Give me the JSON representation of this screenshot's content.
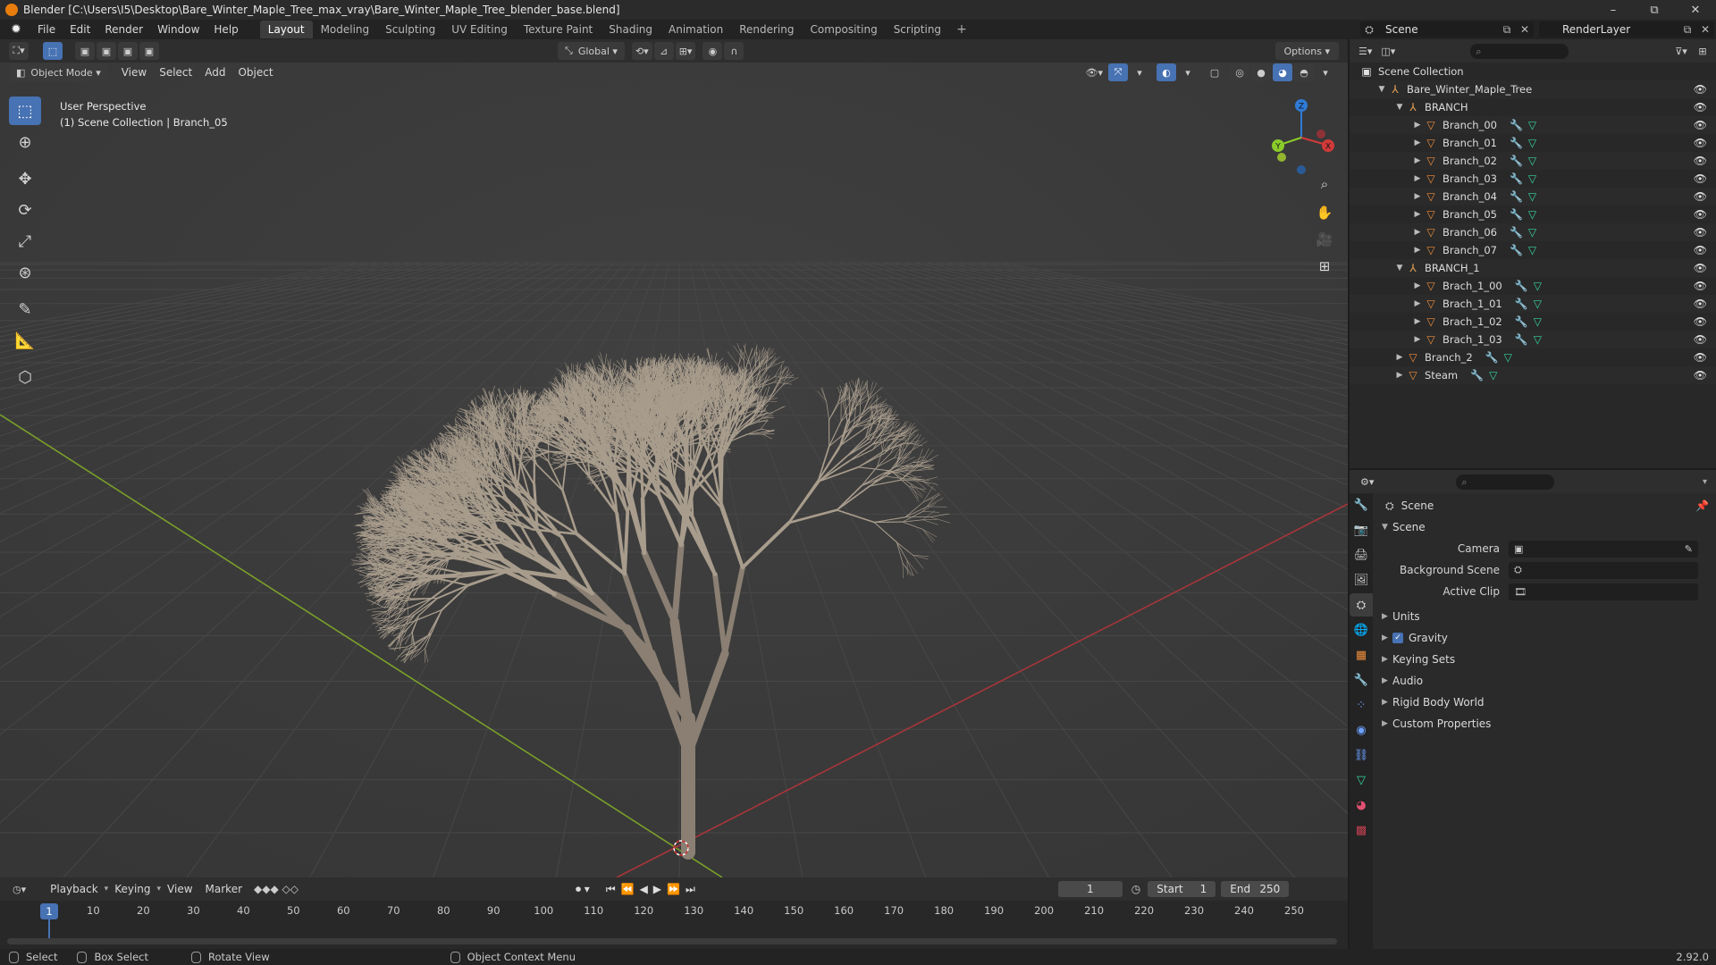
{
  "window": {
    "title": "Blender [C:\\Users\\I5\\Desktop\\Bare_Winter_Maple_Tree_max_vray\\Bare_Winter_Maple_Tree_blender_base.blend]",
    "minimize": "–",
    "maximize": "⧉",
    "close": "✕"
  },
  "menus": [
    "File",
    "Edit",
    "Render",
    "Window",
    "Help"
  ],
  "workspaces": [
    "Layout",
    "Modeling",
    "Sculpting",
    "UV Editing",
    "Texture Paint",
    "Shading",
    "Animation",
    "Rendering",
    "Compositing",
    "Scripting"
  ],
  "active_workspace": "Layout",
  "scene_selector": "Scene",
  "view_layer": "RenderLayer",
  "viewport": {
    "orientation": "Global",
    "options_label": "Options",
    "mode": "Object Mode",
    "header_menus": [
      "View",
      "Select",
      "Add",
      "Object"
    ],
    "info_line1": "User Perspective",
    "info_line2": "(1) Scene Collection | Branch_05",
    "gizmo_axes": {
      "x": "X",
      "y": "Y",
      "z": "Z"
    }
  },
  "tools": [
    "select-box",
    "cursor",
    "move",
    "rotate",
    "scale",
    "transform",
    "annotate",
    "measure",
    "add-cube"
  ],
  "timeline": {
    "menus": [
      "Playback",
      "Keying",
      "View",
      "Marker"
    ],
    "current_frame": "1",
    "start_label": "Start",
    "start": "1",
    "end_label": "End",
    "end": "250",
    "ruler_ticks": [
      "1",
      "10",
      "20",
      "30",
      "40",
      "50",
      "60",
      "70",
      "80",
      "90",
      "100",
      "110",
      "120",
      "130",
      "140",
      "150",
      "160",
      "170",
      "180",
      "190",
      "200",
      "210",
      "220",
      "230",
      "240",
      "250"
    ]
  },
  "status_bar": {
    "select": "Select",
    "box_select": "Box Select",
    "rotate_view": "Rotate View",
    "context_menu": "Object Context Menu",
    "version": "2.92.0"
  },
  "outliner": {
    "root": "Scene Collection",
    "rows": [
      {
        "label": "Bare_Winter_Maple_Tree",
        "indent": 1,
        "type": "empty",
        "mods": false
      },
      {
        "label": "BRANCH",
        "indent": 2,
        "type": "empty",
        "mods": false
      },
      {
        "label": "Branch_00",
        "indent": 3,
        "type": "mesh",
        "mods": true
      },
      {
        "label": "Branch_01",
        "indent": 3,
        "type": "mesh",
        "mods": true
      },
      {
        "label": "Branch_02",
        "indent": 3,
        "type": "mesh",
        "mods": true
      },
      {
        "label": "Branch_03",
        "indent": 3,
        "type": "mesh",
        "mods": true
      },
      {
        "label": "Branch_04",
        "indent": 3,
        "type": "mesh",
        "mods": true
      },
      {
        "label": "Branch_05",
        "indent": 3,
        "type": "mesh",
        "mods": true
      },
      {
        "label": "Branch_06",
        "indent": 3,
        "type": "mesh",
        "mods": true
      },
      {
        "label": "Branch_07",
        "indent": 3,
        "type": "mesh",
        "mods": true
      },
      {
        "label": "BRANCH_1",
        "indent": 2,
        "type": "empty",
        "mods": false
      },
      {
        "label": "Brach_1_00",
        "indent": 3,
        "type": "mesh",
        "mods": true
      },
      {
        "label": "Brach_1_01",
        "indent": 3,
        "type": "mesh",
        "mods": true
      },
      {
        "label": "Brach_1_02",
        "indent": 3,
        "type": "mesh",
        "mods": true
      },
      {
        "label": "Brach_1_03",
        "indent": 3,
        "type": "mesh",
        "mods": true
      },
      {
        "label": "Branch_2",
        "indent": 2,
        "type": "mesh",
        "mods": true
      },
      {
        "label": "Steam",
        "indent": 2,
        "type": "mesh",
        "mods": true
      }
    ]
  },
  "properties": {
    "context_title": "Scene",
    "panel_title": "Scene",
    "fields": [
      {
        "label": "Camera",
        "value": ""
      },
      {
        "label": "Background Scene",
        "value": ""
      },
      {
        "label": "Active Clip",
        "value": ""
      }
    ],
    "subpanels": [
      "Units",
      "Gravity",
      "Keying Sets",
      "Audio",
      "Rigid Body World",
      "Custom Properties"
    ],
    "gravity_checked": true
  },
  "colors": {
    "accent": "#4772b3",
    "x_axis": "#d13a3a",
    "y_axis": "#8acb2b",
    "z_axis": "#2f7bd6",
    "mesh_icon": "#f08d3c",
    "modifier_icon": "#8cb4ff",
    "data_icon": "#35d6a0"
  }
}
